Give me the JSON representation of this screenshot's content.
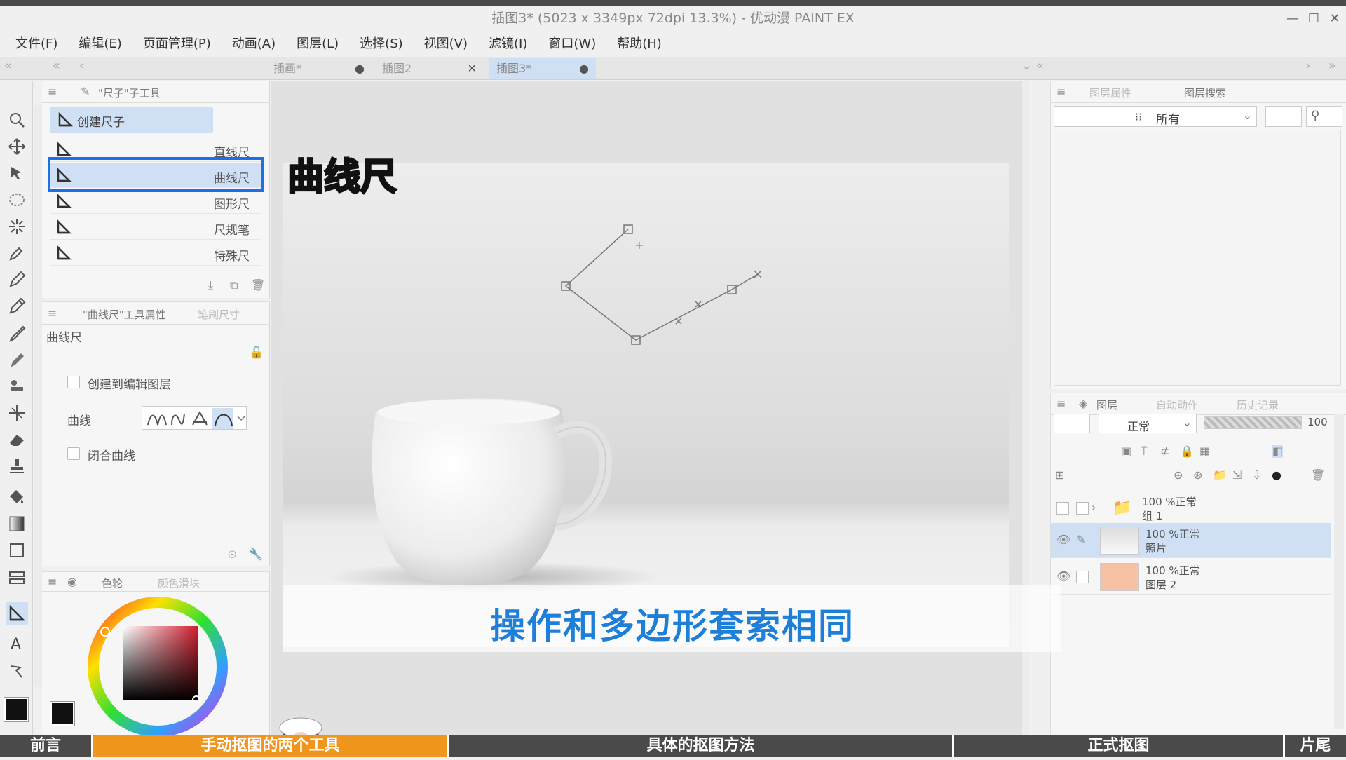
{
  "window": {
    "title": "插图3* (5023 x 3349px 72dpi 13.3%)  - 优动漫 PAINT EX"
  },
  "menu": [
    "文件(F)",
    "编辑(E)",
    "页面管理(P)",
    "动画(A)",
    "图层(L)",
    "选择(S)",
    "视图(V)",
    "滤镜(I)",
    "窗口(W)",
    "帮助(H)"
  ],
  "tabs": [
    {
      "label": "插画*",
      "close": "●"
    },
    {
      "label": "插图2",
      "close": "✕"
    },
    {
      "label": "插图3*",
      "close": "●"
    }
  ],
  "subtool": {
    "title": "\"尺子\"子工具",
    "create": "创建尺子",
    "items": [
      "直线尺",
      "曲线尺",
      "图形尺",
      "尺规笔",
      "特殊尺"
    ]
  },
  "overlay_title": "曲线尺",
  "props": {
    "tab1": "\"曲线尺\"工具属性",
    "tab2": "笔刷尺寸",
    "name": "曲线尺",
    "create_on_edit_layer": "创建到编辑图层",
    "curve_label": "曲线",
    "closed_curve": "闭合曲线"
  },
  "color": {
    "tab1": "色轮",
    "tab2": "颜色滑块"
  },
  "right": {
    "tab1": "图层属性",
    "tab2": "图层搜索",
    "filter": "所有"
  },
  "layers": {
    "tab1": "图层",
    "tab2": "自动动作",
    "tab3": "历史记录",
    "blend": "正常",
    "opacity": "100",
    "rows": [
      {
        "line1": "100 %正常",
        "line2": "组 1"
      },
      {
        "line1": "100 %正常",
        "line2": "照片"
      },
      {
        "line1": "100 %正常",
        "line2": "图层 2"
      }
    ]
  },
  "subtitle": "操作和多边形套索相同",
  "chapters": [
    "前言",
    "手动抠图的两个工具",
    "具体的抠图方法",
    "正式抠图",
    "片尾"
  ],
  "colors": {
    "accent": "#1e7fd8",
    "chapter_active": "#f0951d",
    "highlight": "#1c6fe8",
    "overlay_title": "#f4b21d"
  }
}
